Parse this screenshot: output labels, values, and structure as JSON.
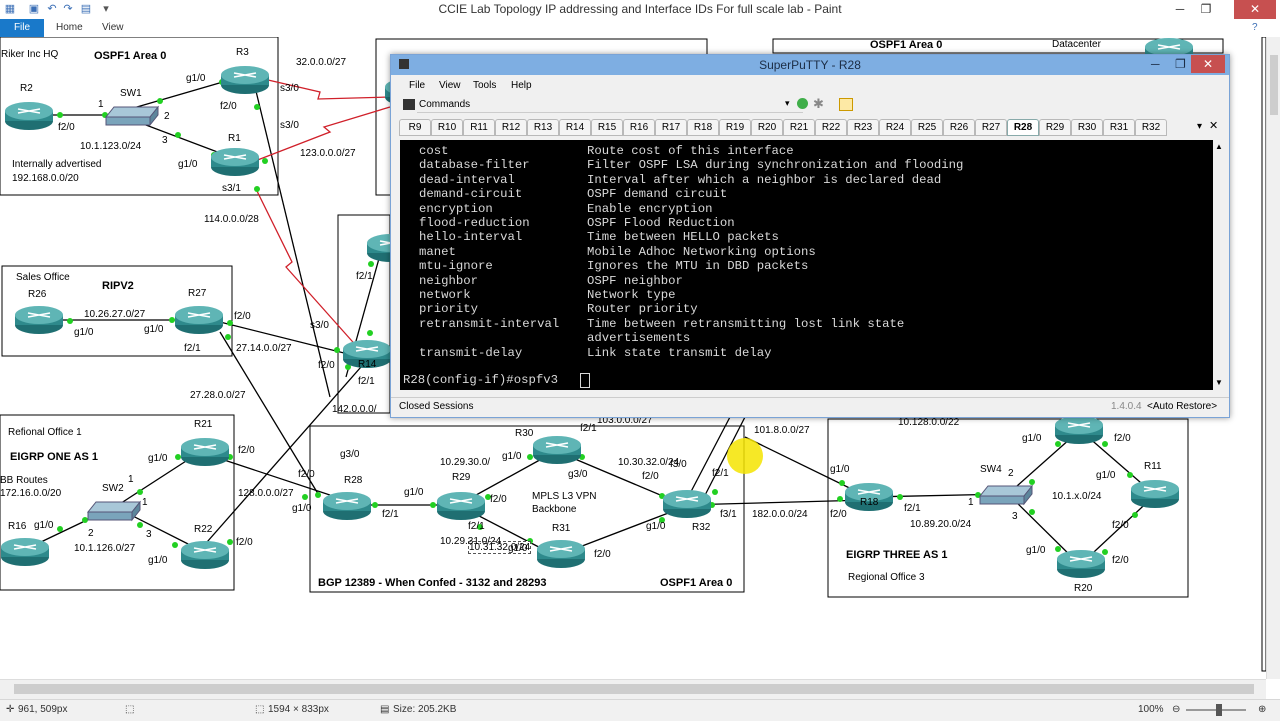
{
  "app": {
    "title": "CCIE Lab Topology IP addressing and Interface IDs For full scale lab - Paint",
    "ribbon_tabs": [
      "File",
      "Home",
      "View"
    ]
  },
  "status": {
    "cursor_pos": "961, 509px",
    "selection": "",
    "image_size": "1594 × 833px",
    "file_size": "Size: 205.2KB",
    "zoom": "100%"
  },
  "diagram": {
    "areas": {
      "hq_title": "Riker Inc HQ",
      "hq_area": "OSPF1 Area 0",
      "hq_adv1": "Internally advertised",
      "hq_adv2": "192.168.0.0/20",
      "dc_area": "OSPF1 Area 0",
      "dc_title": "Datacenter",
      "sales_title": "Sales Office",
      "sales_proto": "RIPV2",
      "ro1_title": "Refional Office 1",
      "ro1_proto": "EIGRP ONE AS 1",
      "ro1_bb1": "BB Routes",
      "ro1_bb2": "172.16.0.0/20",
      "bgp": "BGP 12389 - When Confed - 3132 and 28293",
      "ospf_core": "OSPF1 Area 0",
      "mpls1": "MPLS L3 VPN",
      "mpls2": "Backbone",
      "eigrp3": "EIGRP THREE AS 1",
      "ro3": "Regional Office 3"
    },
    "routers": {
      "r2": "R2",
      "r3": "R3",
      "r1": "R1",
      "sw1": "SW1",
      "r26": "R26",
      "r27": "R27",
      "r14": "R14",
      "r21": "R21",
      "sw2": "SW2",
      "r16": "R16",
      "r22": "R22",
      "r28": "R28",
      "r29": "R29",
      "r30": "R30",
      "r31": "R31",
      "r32": "R32",
      "r18": "R18",
      "sw4": "SW4",
      "r11": "R11",
      "r20": "R20"
    },
    "labels": [
      "32.0.0.0/27",
      "123.0.0.0/27",
      "114.0.0.0/28",
      "10.1.123.0/24",
      "10.26.27.0/27",
      "27.14.0.0/27",
      "27.28.0.0/27",
      "142.0.0.0/",
      "10.1.126.0/27",
      "128.0.0.0/27",
      "10.29.30.0/",
      "10.30.32.0/24",
      "103.0.0.0/27",
      "101.8.0.0/27",
      "182.0.0.0/24",
      "10.128.0.0/22",
      "10.89.20.0/24",
      "10.1.x.0/24",
      "10.31.32.0/24",
      "10.29.31.0/24"
    ],
    "ifaces": {
      "g10": "g1/0",
      "f20": "f2/0",
      "f21": "f2/1",
      "s30": "s3/0",
      "s31": "s3/1",
      "g30": "g3/0",
      "f31": "f3/1",
      "f30": "f3/0",
      "n1": "1",
      "n2": "2",
      "n3": "3"
    }
  },
  "putty": {
    "title": "SuperPuTTY - R28",
    "menu": [
      "File",
      "View",
      "Tools",
      "Help"
    ],
    "commands_label": "Commands",
    "tabs": [
      "R9",
      "R10",
      "R11",
      "R12",
      "R13",
      "R14",
      "R15",
      "R16",
      "R17",
      "R18",
      "R19",
      "R20",
      "R21",
      "R22",
      "R23",
      "R24",
      "R25",
      "R26",
      "R27",
      "R28",
      "R29",
      "R30",
      "R31",
      "R32"
    ],
    "active_tab": "R28",
    "terminal": [
      {
        "cmd": "cost",
        "desc": "Route cost of this interface"
      },
      {
        "cmd": "database-filter",
        "desc": "Filter OSPF LSA during synchronization and flooding"
      },
      {
        "cmd": "dead-interval",
        "desc": "Interval after which a neighbor is declared dead"
      },
      {
        "cmd": "demand-circuit",
        "desc": "OSPF demand circuit"
      },
      {
        "cmd": "encryption",
        "desc": "Enable encryption"
      },
      {
        "cmd": "flood-reduction",
        "desc": "OSPF Flood Reduction"
      },
      {
        "cmd": "hello-interval",
        "desc": "Time between HELLO packets"
      },
      {
        "cmd": "manet",
        "desc": "Mobile Adhoc Networking options"
      },
      {
        "cmd": "mtu-ignore",
        "desc": "Ignores the MTU in DBD packets"
      },
      {
        "cmd": "neighbor",
        "desc": "OSPF neighbor"
      },
      {
        "cmd": "network",
        "desc": "Network type"
      },
      {
        "cmd": "priority",
        "desc": "Router priority"
      },
      {
        "cmd": "retransmit-interval",
        "desc": "Time between retransmitting lost link state"
      },
      {
        "cmd": "",
        "desc": "advertisements"
      },
      {
        "cmd": "transmit-delay",
        "desc": "Link state transmit delay"
      }
    ],
    "prompt": "R28(config-if)#ospfv3",
    "closed_sessions": "Closed Sessions",
    "version": "1.4.0.4",
    "auto_restore": "<Auto Restore>"
  },
  "colors": {
    "router_teal": "#2e8a8c",
    "link_green": "#22d022",
    "serial_red": "#d0202a",
    "paint_file_blue": "#1979ca",
    "putty_title": "#7eaee2"
  }
}
